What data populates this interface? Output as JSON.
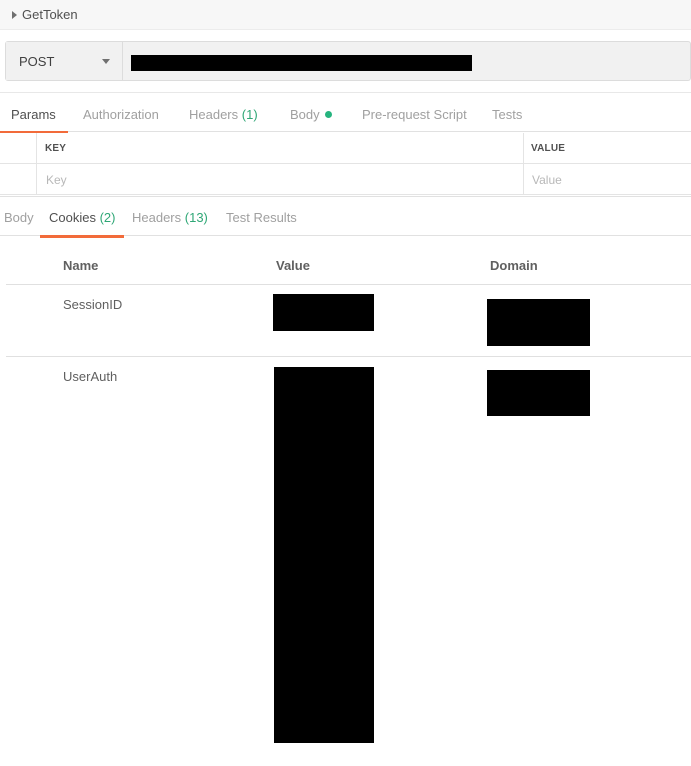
{
  "request": {
    "name": "GetToken",
    "method": "POST",
    "url": ""
  },
  "request_tabs": [
    {
      "label": "Params",
      "active": true
    },
    {
      "label": "Authorization"
    },
    {
      "label": "Headers",
      "count": "(1)"
    },
    {
      "label": "Body",
      "indicator": "green-dot"
    },
    {
      "label": "Pre-request Script"
    },
    {
      "label": "Tests"
    }
  ],
  "params": {
    "key_header": "KEY",
    "value_header": "VALUE",
    "key_placeholder": "Key",
    "value_placeholder": "Value"
  },
  "response_tabs": [
    {
      "label": "Body"
    },
    {
      "label": "Cookies",
      "count": "(2)",
      "active": true
    },
    {
      "label": "Headers",
      "count": "(13)"
    },
    {
      "label": "Test Results"
    }
  ],
  "cookies": {
    "columns": [
      "Name",
      "Value",
      "Domain"
    ],
    "rows": [
      {
        "name": "SessionID",
        "value": "[redacted]",
        "domain": "[redacted]"
      },
      {
        "name": "UserAuth",
        "value": "[redacted]",
        "domain": "[redacted]"
      }
    ]
  },
  "colors": {
    "active_tab_underline": "#f26b3a",
    "count": "#2fa776",
    "body_dot": "#26b47f",
    "redaction": "#000000"
  }
}
